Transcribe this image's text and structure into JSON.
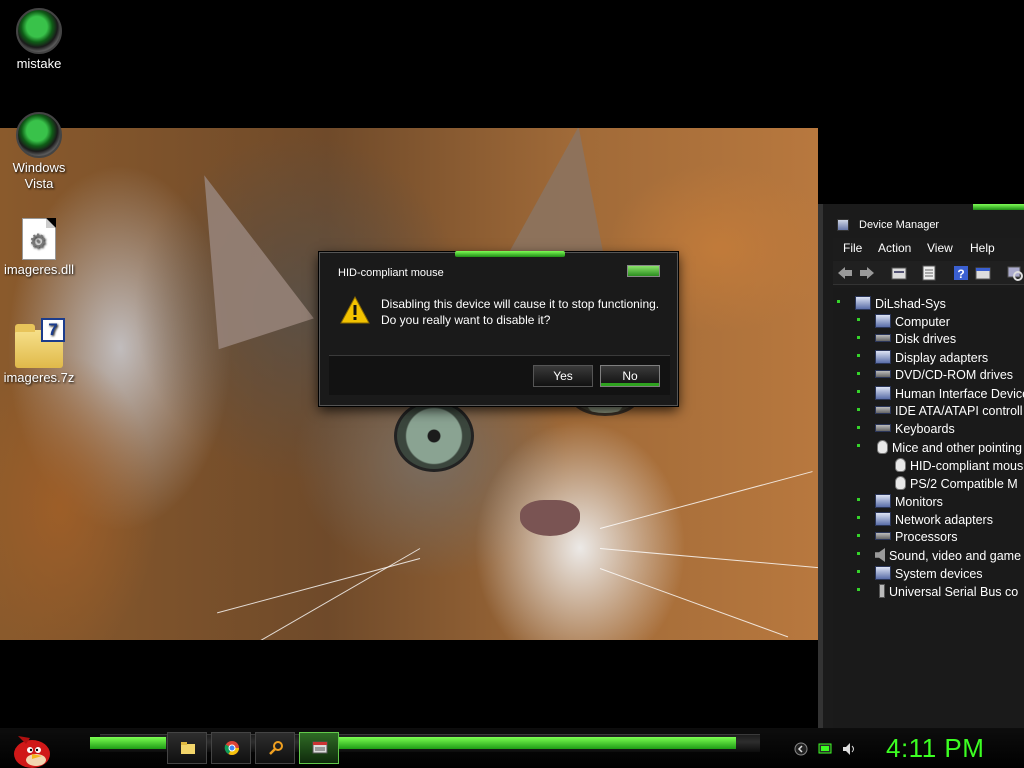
{
  "desktop": {
    "icons": [
      {
        "label": "mistake"
      },
      {
        "label": "Windows Vista"
      },
      {
        "label": "imageres.dll"
      },
      {
        "label": "imageres.7z",
        "badge": "7"
      }
    ]
  },
  "dialog": {
    "title": "HID-compliant mouse",
    "message": "Disabling this device will cause it to stop functioning. Do you really want to disable it?",
    "yes_label": "Yes",
    "no_label": "No",
    "icon": "warning-icon"
  },
  "device_manager": {
    "title": "Device Manager",
    "menu": [
      "File",
      "Action",
      "View",
      "Help"
    ],
    "tree": {
      "root": "DiLshad-Sys",
      "items": [
        "Computer",
        "Disk drives",
        "Display adapters",
        "DVD/CD-ROM drives",
        "Human Interface Device",
        "IDE ATA/ATAPI controll",
        "Keyboards",
        "Mice and other pointing",
        "HID-compliant mous",
        "PS/2 Compatible M",
        "Monitors",
        "Network adapters",
        "Processors",
        "Sound, video and game",
        "System devices",
        "Universal Serial Bus co"
      ]
    }
  },
  "taskbar": {
    "clock": "4:11 PM",
    "apps": [
      "file-explorer-icon",
      "chrome-icon",
      "search-icon",
      "device-manager-icon"
    ]
  },
  "colors": {
    "accent_green": "#3cff22",
    "dialog_bg": "#1a1a1a",
    "warning": "#f2c200"
  }
}
